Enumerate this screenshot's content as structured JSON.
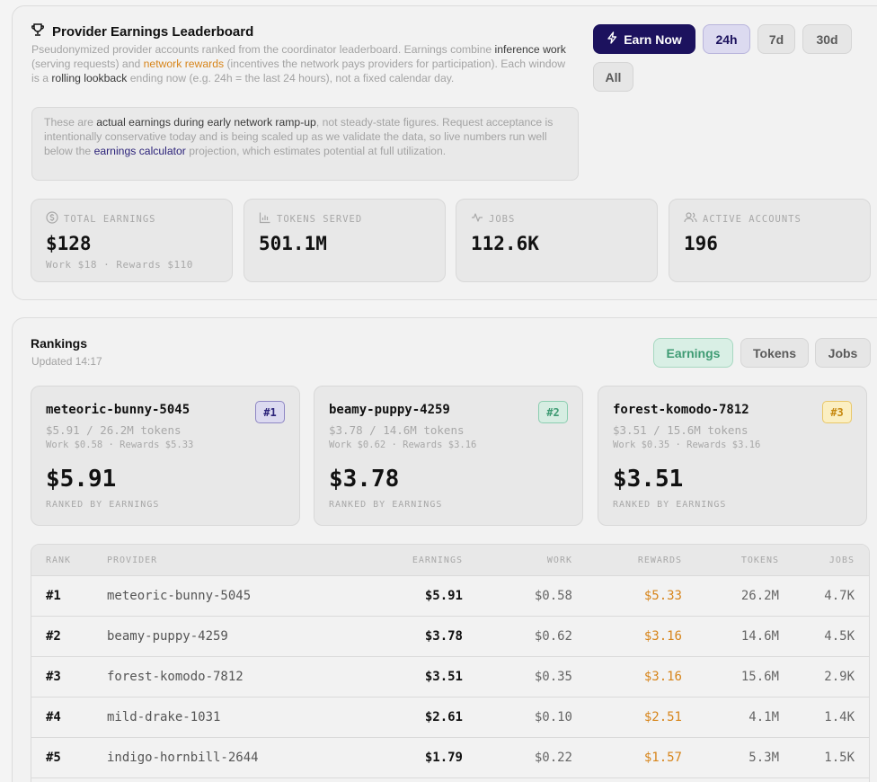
{
  "header": {
    "title": "Provider Earnings Leaderboard",
    "desc": {
      "p1": "Pseudonymized provider accounts ranked from the coordinator leaderboard. Earnings combine ",
      "inference": "inference work",
      "p2": " (serving requests) and ",
      "network": "network rewards",
      "p3": " (incentives the network pays providers for participation). Each window is a ",
      "rolling": "rolling lookback",
      "p4": " ending now (e.g. 24h = the last 24 hours), not a fixed calendar day."
    },
    "note": {
      "p1": "These are ",
      "actual": "actual earnings during early network ramp-up",
      "p2": ", not steady-state figures. Request acceptance is intentionally conservative today and is being scaled up as we validate the data, so live numbers run well below the ",
      "calc": "earnings calculator",
      "p3": " projection, which estimates potential at full utilization."
    },
    "earn_now": "Earn Now",
    "windows": [
      "24h",
      "7d",
      "30d",
      "All"
    ],
    "selected_window": "24h"
  },
  "stats": [
    {
      "label": "TOTAL EARNINGS",
      "icon": "dollar-icon",
      "value": "$128",
      "sub": "Work $18 · Rewards $110"
    },
    {
      "label": "TOKENS SERVED",
      "icon": "bar-chart-icon",
      "value": "501.1M",
      "sub": ""
    },
    {
      "label": "JOBS",
      "icon": "activity-icon",
      "value": "112.6K",
      "sub": ""
    },
    {
      "label": "ACTIVE ACCOUNTS",
      "icon": "users-icon",
      "value": "196",
      "sub": ""
    }
  ],
  "rankings": {
    "title": "Rankings",
    "updated": "Updated 14:17",
    "sort_tabs": [
      "Earnings",
      "Tokens",
      "Jobs"
    ],
    "selected_sort": "Earnings",
    "podium": [
      {
        "name": "meteoric-bunny-5045",
        "badge": "#1",
        "line1": "$5.91 / 26.2M tokens",
        "line2": "Work $0.58 · Rewards $5.33",
        "value": "$5.91",
        "ranked": "RANKED BY EARNINGS"
      },
      {
        "name": "beamy-puppy-4259",
        "badge": "#2",
        "line1": "$3.78 / 14.6M tokens",
        "line2": "Work $0.62 · Rewards $3.16",
        "value": "$3.78",
        "ranked": "RANKED BY EARNINGS"
      },
      {
        "name": "forest-komodo-7812",
        "badge": "#3",
        "line1": "$3.51 / 15.6M tokens",
        "line2": "Work $0.35 · Rewards $3.16",
        "value": "$3.51",
        "ranked": "RANKED BY EARNINGS"
      }
    ],
    "columns": [
      "RANK",
      "PROVIDER",
      "EARNINGS",
      "WORK",
      "REWARDS",
      "TOKENS",
      "JOBS"
    ],
    "rows": [
      {
        "rank": "#1",
        "provider": "meteoric-bunny-5045",
        "earnings": "$5.91",
        "work": "$0.58",
        "rewards": "$5.33",
        "tokens": "26.2M",
        "jobs": "4.7K"
      },
      {
        "rank": "#2",
        "provider": "beamy-puppy-4259",
        "earnings": "$3.78",
        "work": "$0.62",
        "rewards": "$3.16",
        "tokens": "14.6M",
        "jobs": "4.5K"
      },
      {
        "rank": "#3",
        "provider": "forest-komodo-7812",
        "earnings": "$3.51",
        "work": "$0.35",
        "rewards": "$3.16",
        "tokens": "15.6M",
        "jobs": "2.9K"
      },
      {
        "rank": "#4",
        "provider": "mild-drake-1031",
        "earnings": "$2.61",
        "work": "$0.10",
        "rewards": "$2.51",
        "tokens": "4.1M",
        "jobs": "1.4K"
      },
      {
        "rank": "#5",
        "provider": "indigo-hornbill-2644",
        "earnings": "$1.79",
        "work": "$0.22",
        "rewards": "$1.57",
        "tokens": "5.3M",
        "jobs": "1.5K"
      }
    ]
  }
}
